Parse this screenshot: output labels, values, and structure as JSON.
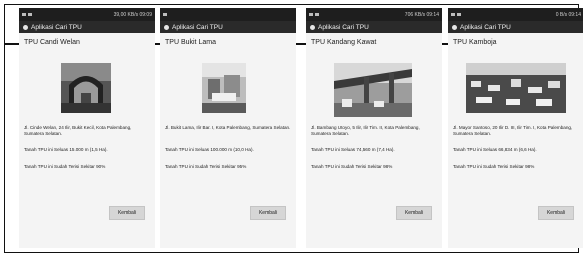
{
  "app_name": "Aplikasi Cari TPU",
  "screens": [
    {
      "status": {
        "speed": "39,00 KB/s",
        "clock": "09:09"
      },
      "title": "TPU Candi Welan",
      "address": "Jl. Cinde Welan, 24 Ilir, Bukit Kecil, Kota Palembang, Sumatera Selatan.",
      "area": "Tanah TPU ini Seluas 15.000 m (1,5 Ha).",
      "filled": "Tanah TPU ini Sudah Terisi Sekitar 90%",
      "back_label": "Kembali"
    },
    {
      "status": {
        "speed": "",
        "clock": ""
      },
      "title": "TPU Bukit Lama",
      "address": "Jl. Bukit Lama, Ilir Bar. I, Kota Palembang, Sumatera Selatan.",
      "area": "Tanah TPU ini Seluas 100.000 m (10,0 Ha).",
      "filled": "Tanah TPU ini Sudah Terisi Sekitar 95%",
      "back_label": "Kembali"
    },
    {
      "status": {
        "speed": "706 KB/s",
        "clock": "09:14"
      },
      "title": "TPU Kandang Kawat",
      "address": "Jl. Bambang Utoyo, 5 Ilir, Ilir Tim. II, Kota Palembang, Sumatera Selatan.",
      "area": "Tanah TPU ini Seluas 74,560 m (7,4 Ha).",
      "filled": "Tanah TPU ini Sudah Terisi Sekitar 98%",
      "back_label": "Kembali"
    },
    {
      "status": {
        "speed": "0 B/s",
        "clock": "09:14"
      },
      "title": "TPU Kamboja",
      "address": "Jl. Mayor Santoso, 20 Ilir D. III, Ilir Tim. I, Kota Palembang, Sumatera Selatan.",
      "area": "Tanah TPU ini Seluas 66,834 m (6,6 Ha).",
      "filled": "Tanah TPU ini Sudah Terisi Sekitar 98%",
      "back_label": "Kembali"
    }
  ]
}
